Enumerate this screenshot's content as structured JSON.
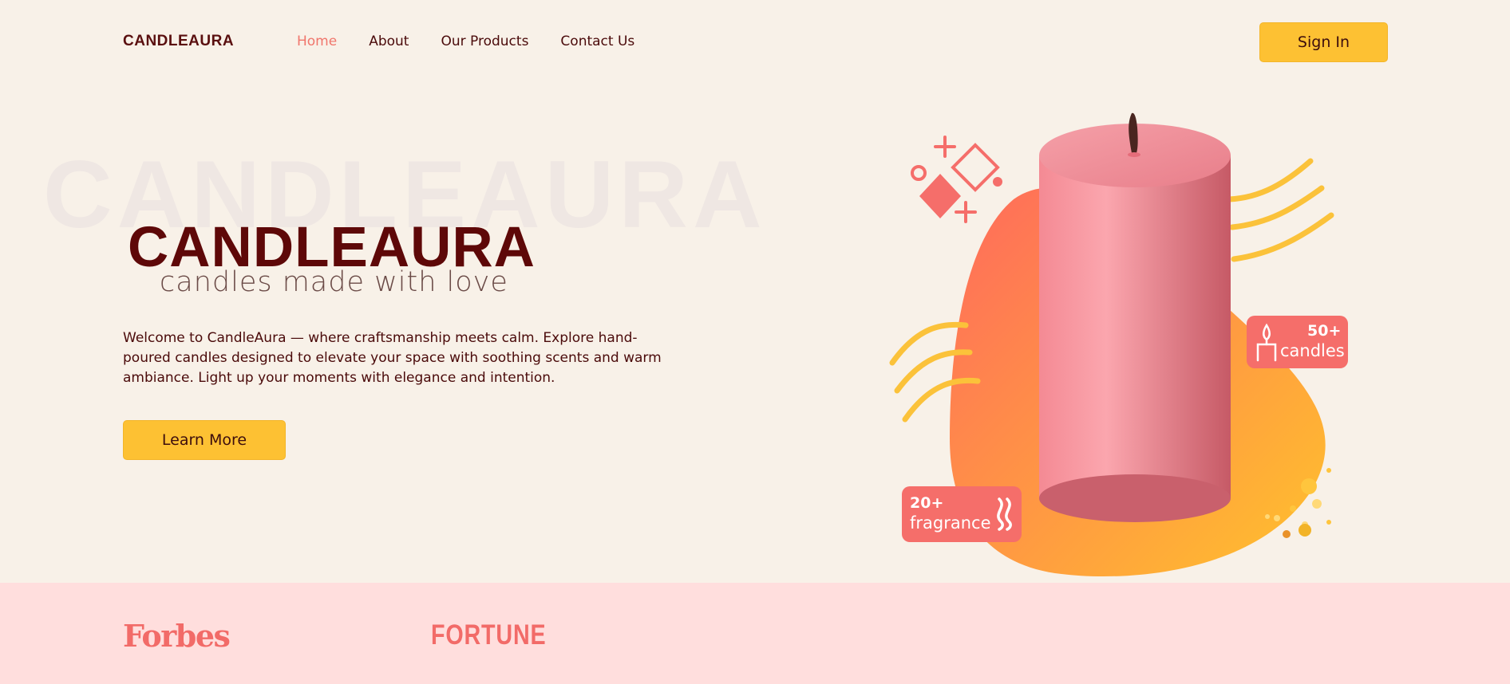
{
  "nav": {
    "logo": "CANDLEAURA",
    "links": [
      {
        "label": "Home",
        "active": true
      },
      {
        "label": "About",
        "active": false
      },
      {
        "label": "Our Products",
        "active": false
      },
      {
        "label": "Contact Us",
        "active": false
      }
    ],
    "signin_label": "Sign In"
  },
  "hero": {
    "background_word": "CANDLEAURA",
    "title": "CANDLEAURA",
    "tagline": "candles made with love",
    "intro": "Welcome to CandleAura — where craftsmanship meets calm. Explore hand-poured candles designed to elevate your space with soothing scents and warm ambiance. Light up your moments with elegance and intention.",
    "cta_label": "Learn More",
    "badges": {
      "candles": {
        "count": "50+",
        "label": "candles",
        "icon": "candle-icon"
      },
      "fragrance": {
        "count": "20+",
        "label": "fragrance",
        "icon": "scent-wave-icon"
      }
    }
  },
  "press": {
    "logos": [
      "Forbes",
      "FORTUNE"
    ]
  },
  "colors": {
    "background": "#f8f1e8",
    "accent_yellow": "#fdc133",
    "accent_coral": "#f56e6a",
    "brand_dark": "#5e0808",
    "press_band": "#ffdedd"
  }
}
